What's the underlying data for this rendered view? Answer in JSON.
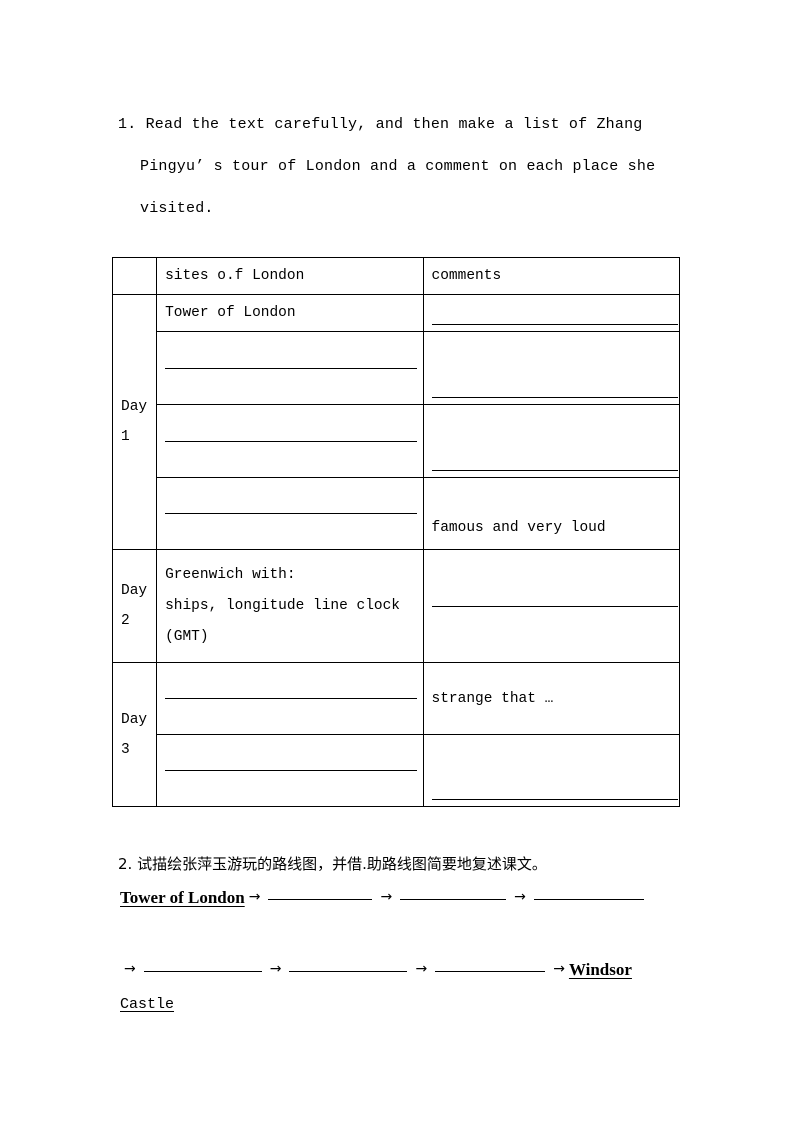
{
  "question1": {
    "number": "1.",
    "lines": [
      "1. Read the text carefully, and then make a list of Zhang",
      "Pingyu’ s tour of London and a comment on each place she",
      "visited."
    ]
  },
  "table": {
    "headers": {
      "day_col": "",
      "sites_col": "sites o.f London",
      "comments_col": "comments"
    },
    "rows": [
      {
        "day": "",
        "day_lines": [],
        "sites": "Tower of London",
        "sites_blank": false,
        "comments": "",
        "comments_blank": true
      },
      {
        "day": "Day 1",
        "day_lines": [
          "Day",
          "1"
        ],
        "sites": "",
        "sites_blank": true,
        "comments": "",
        "comments_blank": true
      },
      {
        "day": "",
        "day_lines": [],
        "sites": "",
        "sites_blank": true,
        "comments": "",
        "comments_blank": true
      },
      {
        "day": "",
        "day_lines": [],
        "sites": "",
        "sites_blank": true,
        "comments": "famous and very loud",
        "comments_blank": false
      },
      {
        "day": "Day 2",
        "day_lines": [
          "Day",
          "2"
        ],
        "sites_multiline": [
          "Greenwich with:",
          "ships, longitude line clock",
          "(GMT)"
        ],
        "sites_blank": false,
        "comments": "",
        "comments_blank": true
      },
      {
        "day": "Day 3",
        "day_lines": [
          "Day",
          "3"
        ],
        "sites": "",
        "sites_blank": true,
        "comments": "strange that …",
        "comments_blank": false
      },
      {
        "day": "",
        "day_lines": [],
        "sites": "",
        "sites_blank": true,
        "comments": "",
        "comments_blank": true
      }
    ]
  },
  "question2": {
    "number": "2.",
    "prompt": "2.  试描绘张萍玉游玩的路线图，并借.助路线图简要地复述课文。",
    "flow_start": "Tower of London",
    "flow_end_line1": "Windsor",
    "flow_end_line2": "Castle",
    "arrow": "→"
  }
}
